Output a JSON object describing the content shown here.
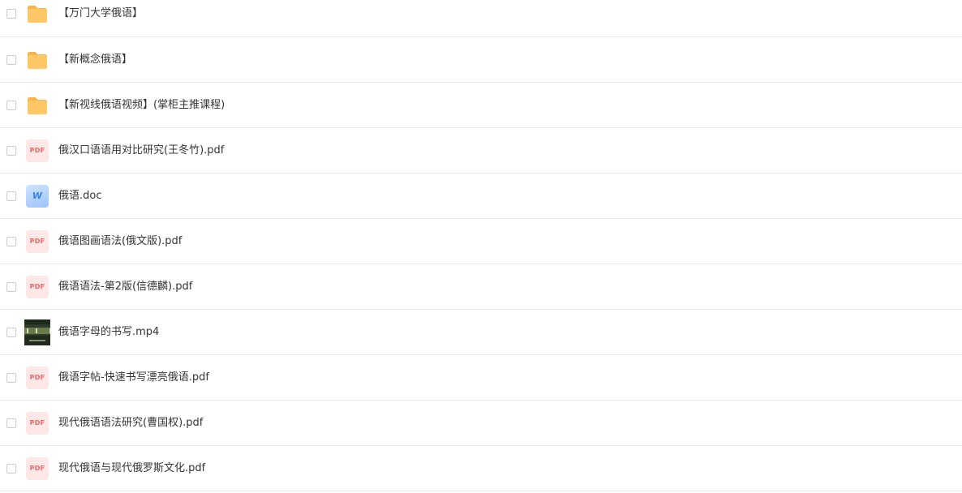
{
  "files": [
    {
      "name": "【万门大学俄语】",
      "type": "folder",
      "icon": "folder-icon"
    },
    {
      "name": "【新概念俄语】",
      "type": "folder",
      "icon": "folder-icon"
    },
    {
      "name": "【新视线俄语视频】(掌柜主推课程)",
      "type": "folder",
      "icon": "folder-icon"
    },
    {
      "name": "俄汉口语语用对比研究(王冬竹).pdf",
      "type": "pdf",
      "icon": "pdf-icon",
      "icon_label": "PDF"
    },
    {
      "name": "俄语.doc",
      "type": "doc",
      "icon": "word-doc-icon",
      "icon_label": "W"
    },
    {
      "name": "俄语图画语法(俄文版).pdf",
      "type": "pdf",
      "icon": "pdf-icon",
      "icon_label": "PDF"
    },
    {
      "name": "俄语语法-第2版(信德麟).pdf",
      "type": "pdf",
      "icon": "pdf-icon",
      "icon_label": "PDF"
    },
    {
      "name": "俄语字母的书写.mp4",
      "type": "video",
      "icon": "video-thumbnail"
    },
    {
      "name": "俄语字帖-快速书写漂亮俄语.pdf",
      "type": "pdf",
      "icon": "pdf-icon",
      "icon_label": "PDF"
    },
    {
      "name": "现代俄语语法研究(曹国权).pdf",
      "type": "pdf",
      "icon": "pdf-icon",
      "icon_label": "PDF"
    },
    {
      "name": "现代俄语与现代俄罗斯文化.pdf",
      "type": "pdf",
      "icon": "pdf-icon",
      "icon_label": "PDF"
    }
  ],
  "colors": {
    "folder": "#ffc766",
    "pdf_bg": "#fde7e7",
    "pdf_text": "#f06a6a",
    "word": "#3b7ff0",
    "divider": "#e8e9eb",
    "text": "#333333"
  }
}
